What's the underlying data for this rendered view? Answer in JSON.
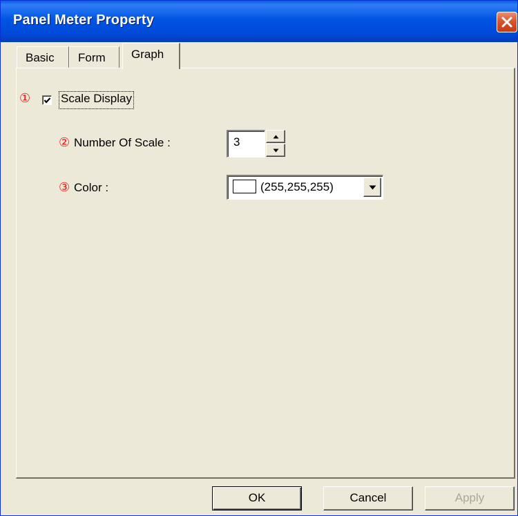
{
  "window": {
    "title": "Panel Meter Property"
  },
  "tabs": [
    {
      "label": "Basic",
      "active": false
    },
    {
      "label": "Form",
      "active": false
    },
    {
      "label": "Graph",
      "active": true
    }
  ],
  "graph": {
    "scale_display": {
      "marker": "①",
      "label": "Scale Display",
      "checked": true
    },
    "number_of_scale": {
      "marker": "②",
      "label": "Number Of Scale :",
      "value": "3"
    },
    "color": {
      "marker": "③",
      "label": "Color :",
      "value": "(255,255,255)",
      "swatch_color": "#ffffff"
    }
  },
  "buttons": {
    "ok": "OK",
    "cancel": "Cancel",
    "apply": "Apply"
  },
  "colors": {
    "titlebar": "#0054e3",
    "background": "#ece9d8",
    "marker": "#ee1111",
    "close_button": "#d8552f"
  },
  "icons": {
    "close": "close-icon",
    "check": "check-icon",
    "spin_up": "arrow-up-icon",
    "spin_down": "arrow-down-icon",
    "dropdown": "chevron-down-icon"
  }
}
